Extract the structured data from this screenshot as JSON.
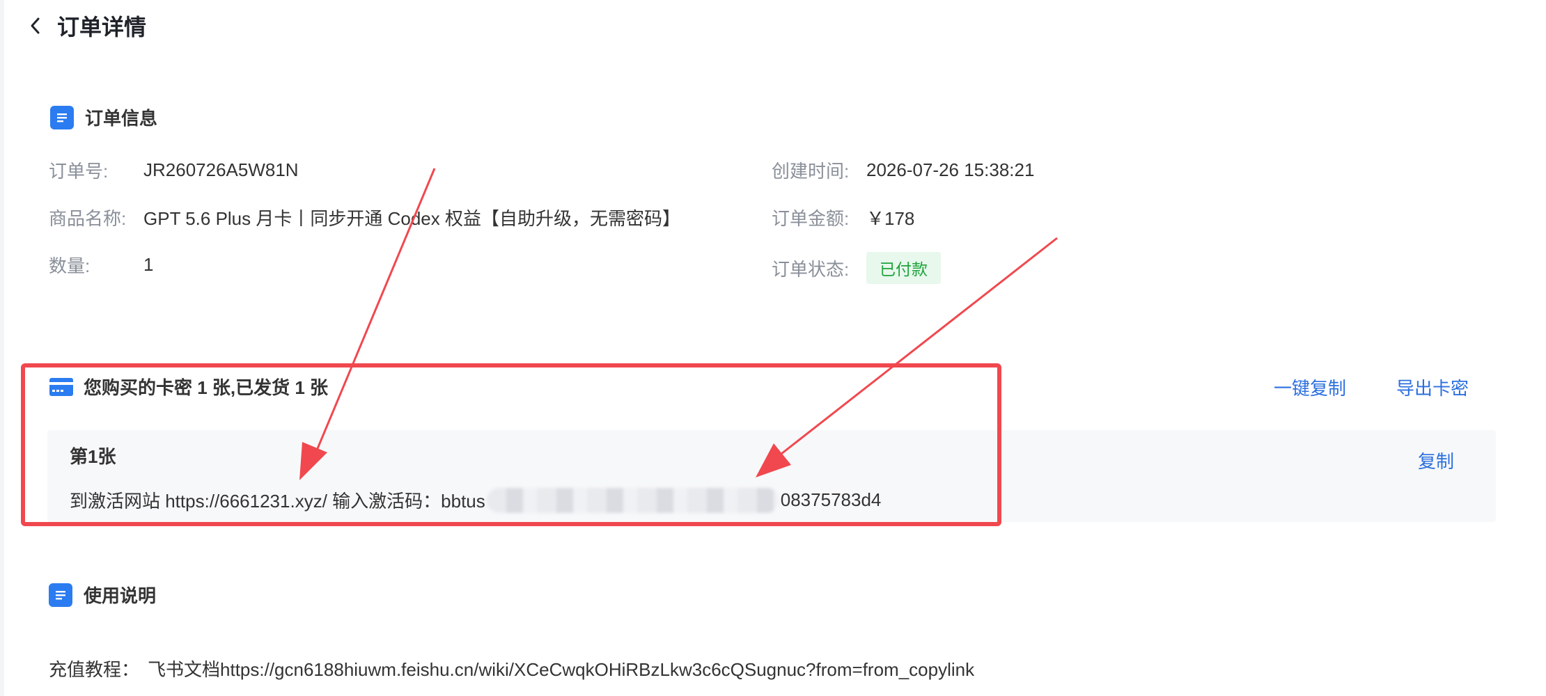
{
  "header": {
    "title": "订单详情"
  },
  "order_info": {
    "section_title": "订单信息",
    "order_no_label": "订单号:",
    "order_no": "JR260726A5W81N",
    "product_label": "商品名称:",
    "product": "GPT 5.6 Plus 月卡丨同步开通 Codex 权益【自助升级，无需密码】",
    "quantity_label": "数量:",
    "quantity": "1",
    "created_label": "创建时间:",
    "created": "2026-07-26 15:38:21",
    "amount_label": "订单金额:",
    "amount": "￥178",
    "status_label": "订单状态:",
    "status": "已付款"
  },
  "cards": {
    "section_title": "您购买的卡密 1 张,已发货 1 张",
    "copy_all_label": "一键复制",
    "export_label": "导出卡密",
    "items": [
      {
        "title": "第1张",
        "copy_label": "复制",
        "text_prefix": "到激活网站 https://6661231.xyz/ 输入激活码：bbtus",
        "text_suffix": "08375783d4"
      }
    ]
  },
  "usage": {
    "section_title": "使用说明",
    "tutorial_label": "充值教程：",
    "tutorial_text": "飞书文档https://gcn6188hiuwm.feishu.cn/wiki/XCeCwqkOHiRBzLkw3c6cQSugnuc?from=from_copylink"
  },
  "colors": {
    "accent": "#2b7cf0",
    "link": "#2b6fde",
    "paid_bg": "#e8f8ec",
    "paid_text": "#1fa33c",
    "annotation_red": "#f0484e"
  },
  "icons": {
    "back": "chevron-left-icon",
    "order_info": "document-list-icon",
    "cards": "credit-card-icon",
    "usage": "document-list-icon"
  }
}
